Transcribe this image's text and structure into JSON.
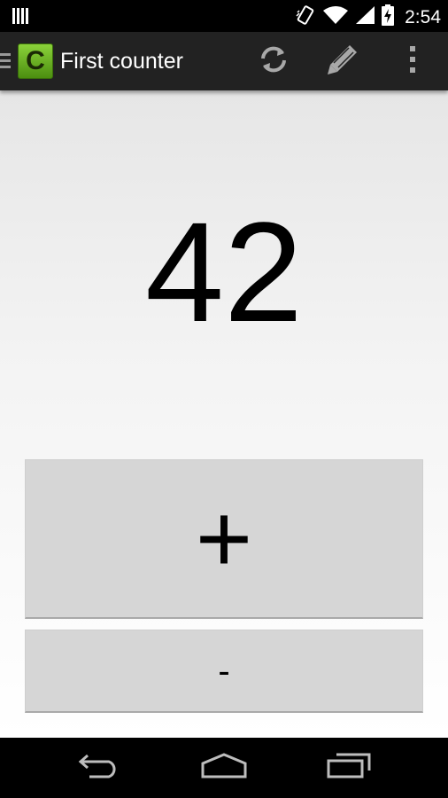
{
  "status_bar": {
    "time": "2:54",
    "icons": [
      "notification-icon",
      "vibrate-icon",
      "wifi-icon",
      "signal-icon",
      "battery-charging-icon"
    ]
  },
  "action_bar": {
    "app_icon_letter": "C",
    "title": "First counter",
    "actions": [
      "refresh-icon",
      "edit-icon",
      "overflow-menu-icon"
    ],
    "accent_color": "#6db322"
  },
  "counter": {
    "value": "42"
  },
  "buttons": {
    "increment_label": "+",
    "decrement_label": "-"
  },
  "nav_bar": {
    "icons": [
      "back-icon",
      "home-icon",
      "recents-icon"
    ]
  }
}
